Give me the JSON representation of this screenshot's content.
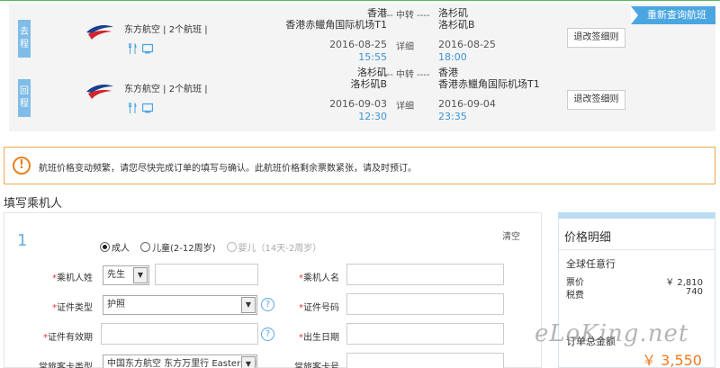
{
  "requery_label": "重新查询航班",
  "trips": [
    {
      "tag": "去程",
      "airline": "东方航空 | 2个航班 |",
      "dep_city": "香港",
      "dep_airport": "香港赤鱲角国际机场T1",
      "dep_date": "2016-08-25",
      "dep_time": "15:55",
      "transfer": "---- 中转 ----",
      "detail": "详细",
      "arr_city": "洛杉矶",
      "arr_airport": "洛杉矶B",
      "arr_date": "2016-08-25",
      "arr_time": "18:00",
      "rule_button": "退改签细则"
    },
    {
      "tag": "回程",
      "airline": "东方航空 | 2个航班 |",
      "dep_city": "洛杉矶",
      "dep_airport": "洛杉矶B",
      "dep_date": "2016-09-03",
      "dep_time": "12:30",
      "transfer": "---- 中转 ----",
      "detail": "详细",
      "arr_city": "香港",
      "arr_airport": "香港赤鱲角国际机场T1",
      "arr_date": "2016-09-04",
      "arr_time": "23:35",
      "rule_button": "退改签细则"
    }
  ],
  "notice": {
    "icon": "exclamation-icon",
    "text": "航班价格变动频繁，请您尽快完成订单的填写与确认。此航班价格剩余票数紧张，请及时预订。"
  },
  "section_title": "填写乘机人",
  "passenger": {
    "number": "1",
    "clear": "清空",
    "types": [
      {
        "label": "成人",
        "selected": true,
        "disabled": false
      },
      {
        "label": "儿童(2-12周岁)",
        "selected": false,
        "disabled": false
      },
      {
        "label": "婴儿（14天-2周岁）",
        "selected": false,
        "disabled": true
      }
    ],
    "surname_label": "乘机人姓",
    "title_select": "先生",
    "surname_value": "",
    "given_label": "乘机人名",
    "given_value": "",
    "id_type_label": "证件类型",
    "id_type_value": "护照",
    "id_no_label": "证件号码",
    "id_no_value": "",
    "id_expiry_label": "证件有效期",
    "id_expiry_value": "",
    "birth_label": "出生日期",
    "birth_value": "",
    "ff_type_label": "常旅客卡类型",
    "ff_type_value": "中国东方航空 东方万里行 Eastern Miles",
    "ff_no_label": "常旅客卡号",
    "ff_no_value": ""
  },
  "price": {
    "title": "价格明细",
    "trip_type": "全球任意行",
    "fare_label": "票价",
    "fare_value": "￥ 2,810",
    "tax_label": "税费",
    "tax_value": "740",
    "total_label": "订单总金额",
    "total_value": "￥ 3,550"
  },
  "watermark": "eLoKing.net",
  "colors": {
    "accent_blue": "#4aa6e0",
    "time_blue": "#3a93d6",
    "notice_border": "#f0a64f",
    "price_orange": "#f47a1f"
  }
}
